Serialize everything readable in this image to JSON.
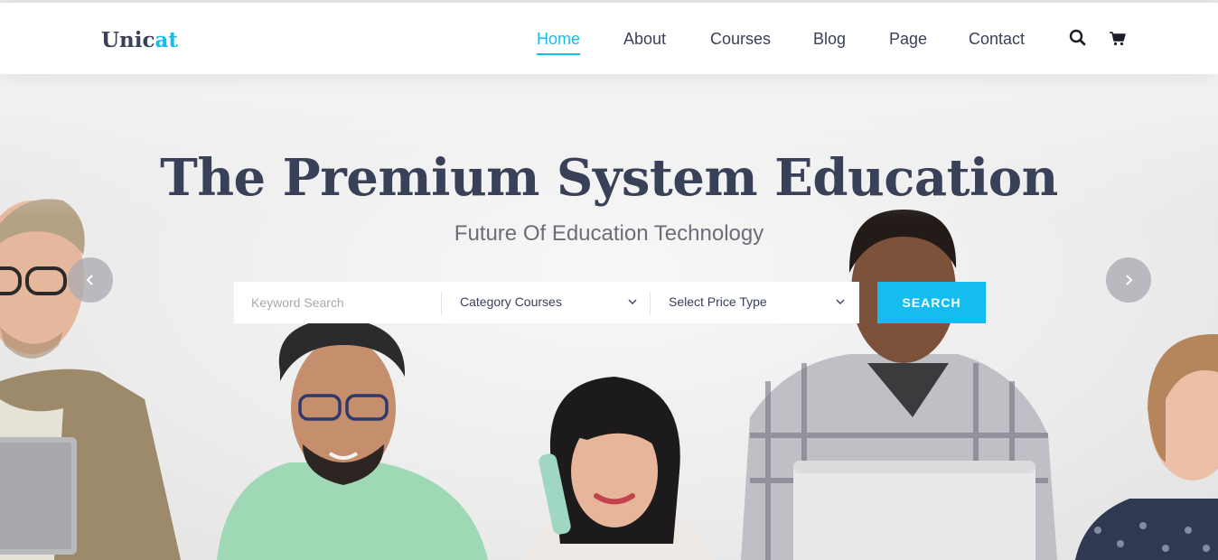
{
  "header": {
    "logo": {
      "part1": "Unic",
      "part2": "at"
    },
    "nav": [
      {
        "label": "Home",
        "active": true
      },
      {
        "label": "About",
        "active": false
      },
      {
        "label": "Courses",
        "active": false
      },
      {
        "label": "Blog",
        "active": false
      },
      {
        "label": "Page",
        "active": false
      },
      {
        "label": "Contact",
        "active": false
      }
    ],
    "icons": [
      "search-icon",
      "cart-icon"
    ]
  },
  "hero": {
    "title": "The Premium System Education",
    "subtitle": "Future Of Education Technology",
    "search": {
      "keyword_placeholder": "Keyword Search",
      "category_select": "Category Courses",
      "price_select": "Select Price Type",
      "button_label": "SEARCH"
    },
    "arrows": [
      "chevron-left-icon",
      "chevron-right-icon"
    ]
  },
  "colors": {
    "accent": "#14bdee",
    "heading": "#384158",
    "subtitle": "#6b6e78"
  }
}
